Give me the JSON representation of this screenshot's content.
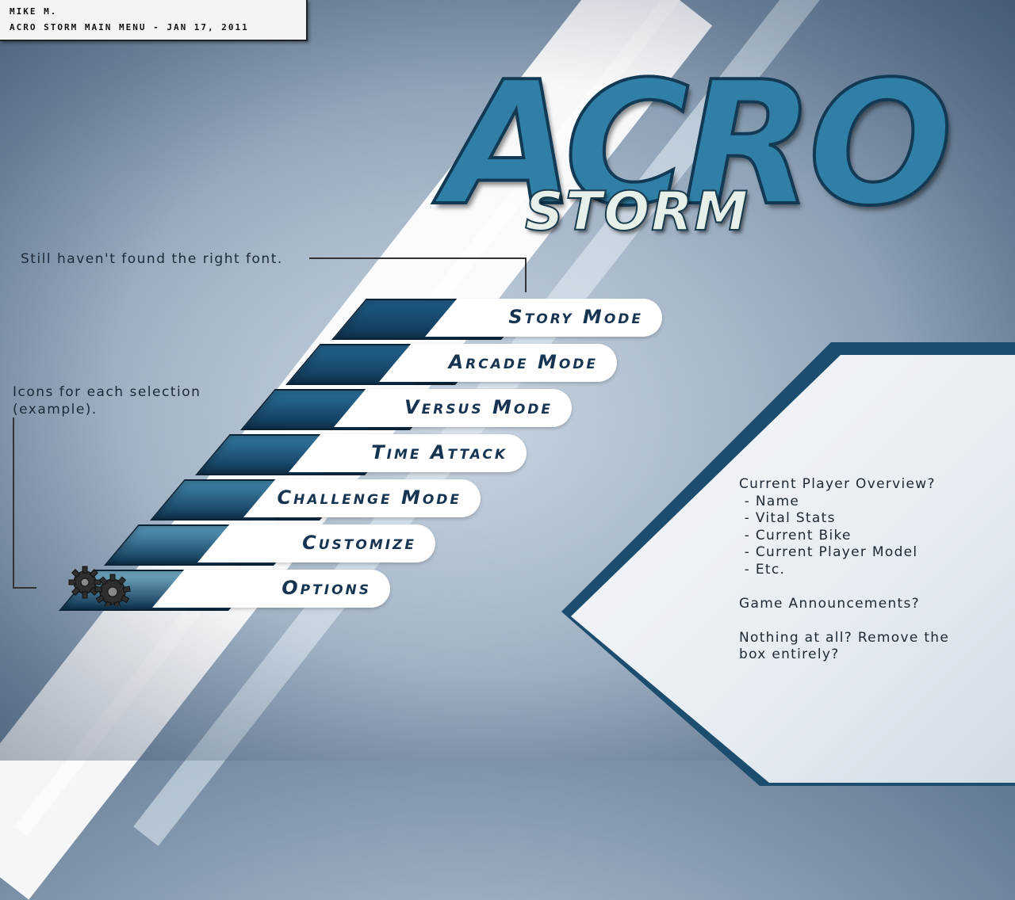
{
  "header": {
    "author": "MIKE M.",
    "caption": "ACRO STORM MAIN MENU - JAN 17, 2011"
  },
  "logo": {
    "primary": "ACRO",
    "secondary": "STORM"
  },
  "notes": {
    "font_note": "Still haven't found the right font.",
    "icons_note": "Icons for each selection (example)."
  },
  "menu": {
    "items": [
      {
        "label": "Story Mode",
        "band_color": "#1f5d86"
      },
      {
        "label": "Arcade Mode",
        "band_color": "#25668f"
      },
      {
        "label": "Versus Mode",
        "band_color": "#2b6f98"
      },
      {
        "label": "Time Attack",
        "band_color": "#3479a1"
      },
      {
        "label": "Challenge Mode",
        "band_color": "#4387ad"
      },
      {
        "label": "Customize",
        "band_color": "#5a9bbd"
      },
      {
        "label": "Options",
        "band_color": "#77afc9",
        "icon": "gears-icon"
      }
    ]
  },
  "panel": {
    "lines": [
      "Current Player Overview?",
      " - Name",
      " - Vital Stats",
      " - Current Bike",
      " - Current Player Model",
      " - Etc.",
      "",
      "Game Announcements?",
      "",
      "Nothing at all? Remove the",
      "box entirely?"
    ]
  },
  "colors": {
    "accent": "#1c4d6e",
    "menu_text": "#163451"
  }
}
